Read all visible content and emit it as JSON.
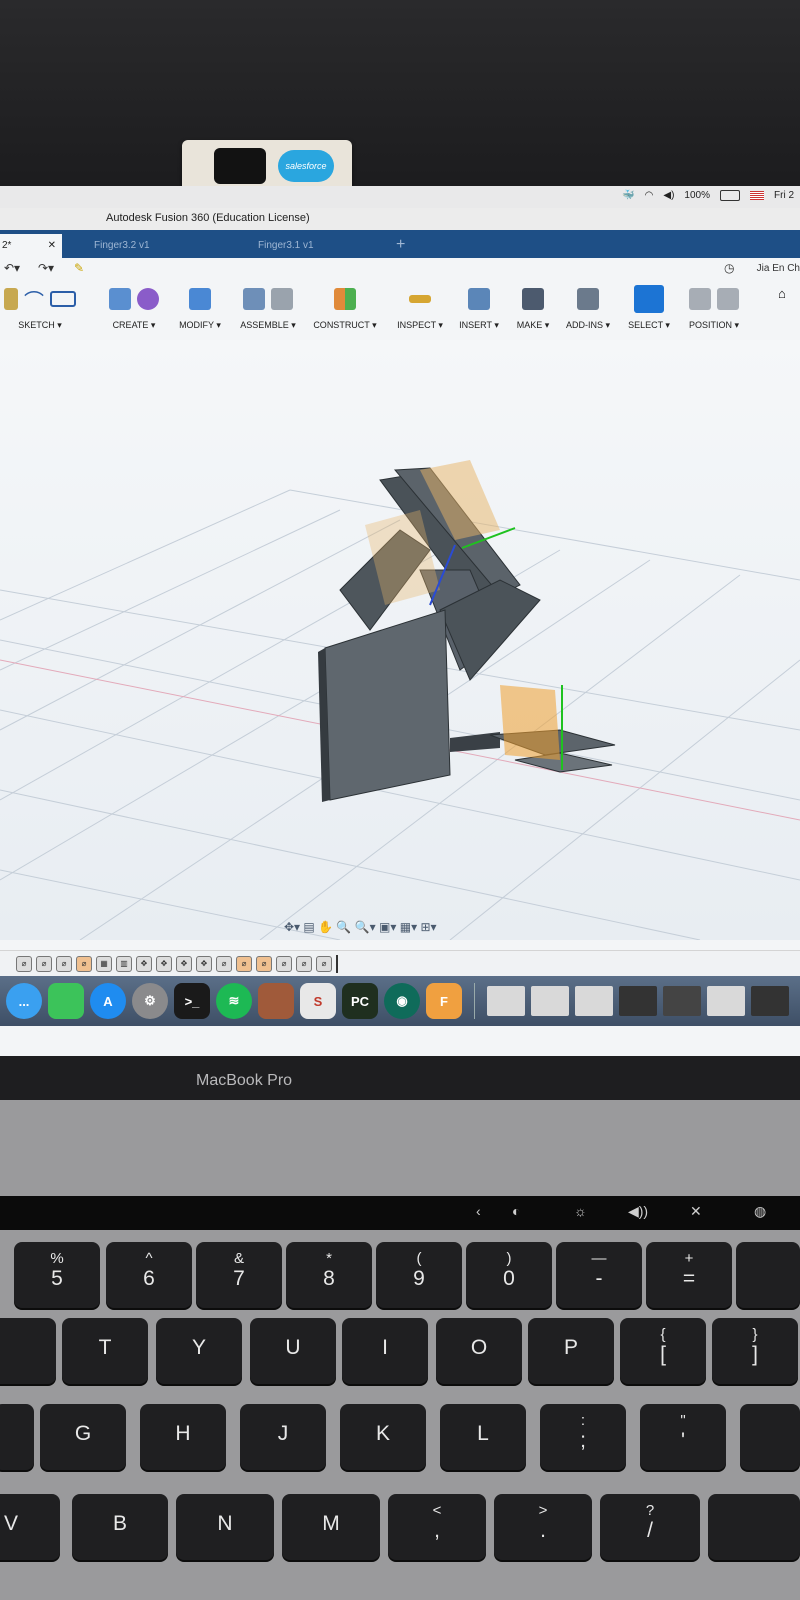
{
  "webcam_cover": {
    "logo_text": "salesforce"
  },
  "menubar": {
    "battery": "100%",
    "flag": "",
    "clock": "Fri 2"
  },
  "window": {
    "title": "Autodesk Fusion 360 (Education License)"
  },
  "tabs": [
    {
      "label": "2*",
      "active": true
    },
    {
      "label": "Finger3.2 v1",
      "active": false
    },
    {
      "label": "Finger3.1 v1",
      "active": false
    }
  ],
  "quickbar": {
    "user": "Jia En Ch"
  },
  "toolbar": {
    "groups": [
      {
        "label": "SKETCH ▾"
      },
      {
        "label": "CREATE ▾"
      },
      {
        "label": "MODIFY ▾"
      },
      {
        "label": "ASSEMBLE ▾"
      },
      {
        "label": "CONSTRUCT ▾"
      },
      {
        "label": "INSPECT ▾"
      },
      {
        "label": "INSERT ▾"
      },
      {
        "label": "MAKE ▾"
      },
      {
        "label": "ADD-INS ▾"
      },
      {
        "label": "SELECT ▾"
      },
      {
        "label": "POSITION ▾"
      }
    ]
  },
  "dock": {
    "apps": [
      {
        "name": "Messages",
        "icon": "messages-icon",
        "color": "#3aa0f0",
        "text": "..."
      },
      {
        "name": "FaceTime",
        "icon": "facetime-icon",
        "color": "#3cc35a",
        "text": ""
      },
      {
        "name": "App Store",
        "icon": "app-store-icon",
        "color": "#1f8cf0",
        "text": "A"
      },
      {
        "name": "System Preferences",
        "icon": "settings-icon",
        "color": "#8a8a8c",
        "text": "⚙"
      },
      {
        "name": "Terminal",
        "icon": "terminal-icon",
        "color": "#1a1a1a",
        "text": ">_"
      },
      {
        "name": "Spotify",
        "icon": "spotify-icon",
        "color": "#1db954",
        "text": "≋"
      },
      {
        "name": "Numbers",
        "icon": "numbers-icon",
        "color": "#a05a3a",
        "text": ""
      },
      {
        "name": "Slack",
        "icon": "slack-icon",
        "color": "#e8e8e8",
        "text": "S"
      },
      {
        "name": "PyCharm",
        "icon": "pycharm-icon",
        "color": "#1f2f1f",
        "text": "PC"
      },
      {
        "name": "GitKraken",
        "icon": "gitkraken-icon",
        "color": "#0f6b5a",
        "text": "◉"
      },
      {
        "name": "Fusion 360",
        "icon": "fusion360-icon",
        "color": "#f0a040",
        "text": "F"
      }
    ]
  },
  "laptop": {
    "model": "MacBook Pro"
  },
  "touchbar": {
    "items": [
      "‹",
      "◐",
      "☼",
      "◀))",
      "✕",
      "◍"
    ]
  },
  "keyboard": {
    "number_row": [
      {
        "top": "%",
        "main": "5"
      },
      {
        "top": "^",
        "main": "6"
      },
      {
        "top": "&",
        "main": "7"
      },
      {
        "top": "*",
        "main": "8"
      },
      {
        "top": "(",
        "main": "9"
      },
      {
        "top": ")",
        "main": "0"
      },
      {
        "top": "—",
        "main": "-"
      },
      {
        "top": "+",
        "main": "="
      }
    ],
    "row_t": [
      "T",
      "Y",
      "U",
      "I",
      "O",
      "P"
    ],
    "row_t_extra": [
      {
        "top": "{",
        "main": "["
      },
      {
        "top": "}",
        "main": "]"
      }
    ],
    "row_g": [
      "G",
      "H",
      "J",
      "K",
      "L"
    ],
    "row_g_extra": [
      {
        "top": ":",
        "main": ";"
      },
      {
        "top": "\"",
        "main": "'"
      }
    ],
    "row_v": [
      "V",
      "B",
      "N",
      "M"
    ],
    "row_v_extra": [
      {
        "top": "<",
        "main": ","
      },
      {
        "top": ">",
        "main": "."
      },
      {
        "top": "?",
        "main": "/"
      }
    ]
  }
}
